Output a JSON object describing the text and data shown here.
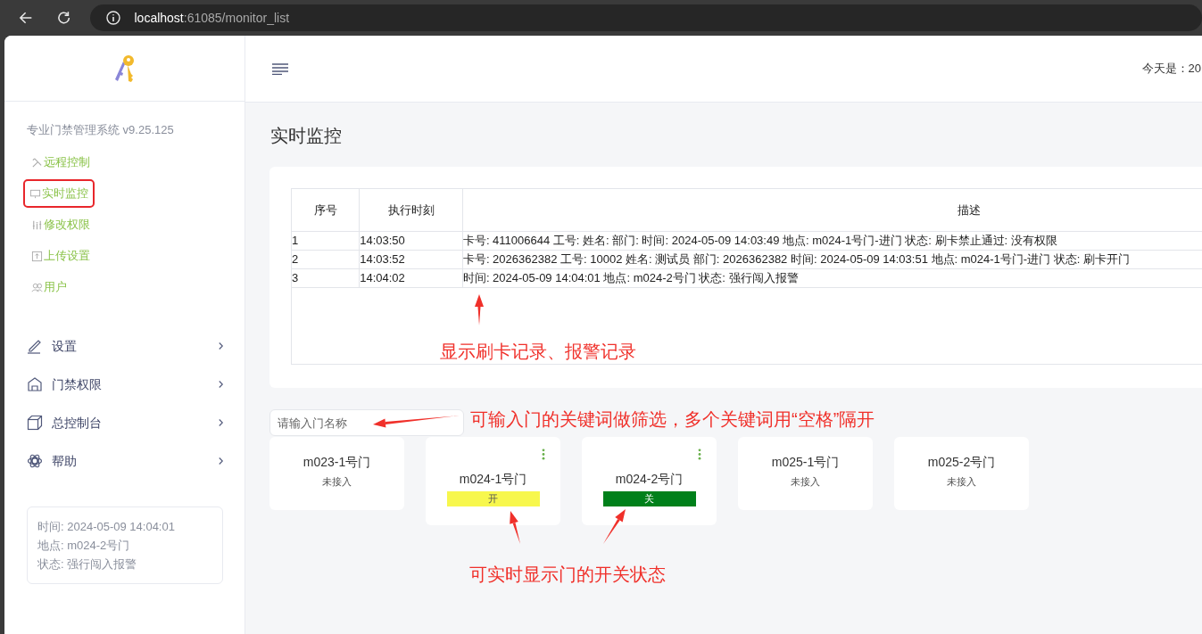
{
  "browser": {
    "host": "localhost",
    "path": ":61085/monitor_list"
  },
  "sidebar": {
    "title": "专业门禁管理系统 v9.25.125",
    "links": [
      {
        "label": "远程控制",
        "boxed": false
      },
      {
        "label": "实时监控",
        "boxed": true
      },
      {
        "label": "修改权限",
        "boxed": false
      },
      {
        "label": "上传设置",
        "boxed": false
      },
      {
        "label": "用户",
        "boxed": false
      }
    ],
    "menu": [
      {
        "label": "设置"
      },
      {
        "label": "门禁权限"
      },
      {
        "label": "总控制台"
      },
      {
        "label": "帮助"
      }
    ],
    "info_lines": [
      "时间: 2024-05-09 14:04:01",
      "地点: m024-2号门",
      "状态: 强行闯入报警"
    ]
  },
  "header": {
    "date_label": "今天是：20"
  },
  "page_title": "实时监控",
  "table": {
    "columns": [
      "序号",
      "执行时刻",
      "描述"
    ],
    "rows": [
      [
        "1",
        "14:03:50",
        "卡号: 411006644 工号: 姓名: 部门: 时间: 2024-05-09 14:03:49 地点: m024-1号门-进门 状态: 刷卡禁止通过: 没有权限"
      ],
      [
        "2",
        "14:03:52",
        "卡号: 2026362382 工号: 10002 姓名: 测试员 部门: 2026362382 时间: 2024-05-09 14:03:51 地点: m024-1号门-进门 状态: 刷卡开门"
      ],
      [
        "3",
        "14:04:02",
        "时间: 2024-05-09 14:04:01 地点: m024-2号门 状态: 强行闯入报警"
      ]
    ]
  },
  "search": {
    "placeholder": "请输入门名称"
  },
  "doors": [
    {
      "name": "m023-1号门",
      "kind": "offline",
      "note": "未接入"
    },
    {
      "name": "m024-1号门",
      "kind": "status",
      "open": true,
      "label": "开"
    },
    {
      "name": "m024-2号门",
      "kind": "status",
      "open": false,
      "label": "关"
    },
    {
      "name": "m025-1号门",
      "kind": "offline",
      "note": "未接入"
    },
    {
      "name": "m025-2号门",
      "kind": "offline",
      "note": "未接入"
    }
  ],
  "annotations": [
    {
      "text": "显示刷卡记录、报警记录"
    },
    {
      "text": "可输入门的关键词做筛选，多个关键词用“空格”隔开"
    },
    {
      "text": "可实时显示门的开关状态"
    }
  ]
}
